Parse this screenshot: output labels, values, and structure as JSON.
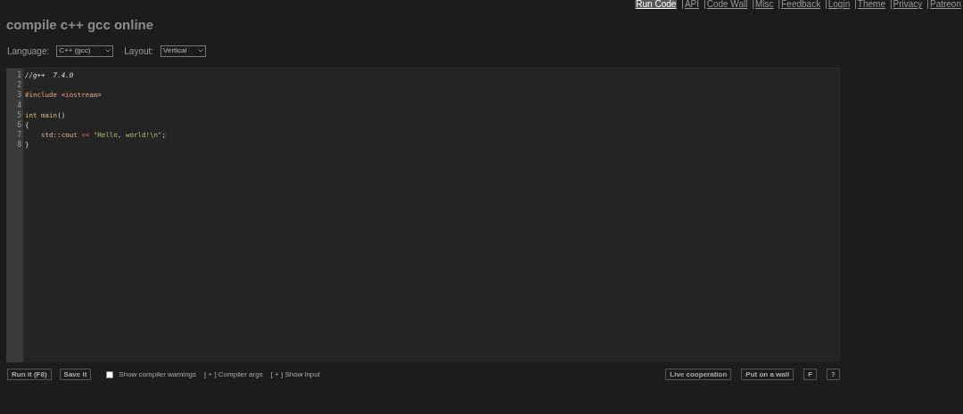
{
  "nav": [
    {
      "label": "Run Code",
      "selected": true
    },
    {
      "prefix": "|",
      "label": "API",
      "selected": false
    },
    {
      "prefix": "|",
      "label": "Code Wall",
      "selected": false
    },
    {
      "prefix": "|",
      "label": "Misc",
      "selected": false
    },
    {
      "prefix": "|",
      "label": "Feedback",
      "selected": false
    },
    {
      "prefix": "|",
      "label": "Login",
      "selected": false
    },
    {
      "prefix": "|",
      "label": "Theme",
      "selected": false
    },
    {
      "prefix": "|",
      "label": "Privacy",
      "selected": false
    },
    {
      "prefix": "|",
      "label": "Patreon",
      "selected": false
    }
  ],
  "title": "compile c++ gcc online",
  "options": [
    {
      "label": "Language:",
      "value": "C++ (gcc)"
    },
    {
      "label": "Layout:",
      "value": "Vertical"
    }
  ],
  "editor": {
    "lines": [
      {
        "number": "1",
        "tokens": [
          {
            "kind": "comment",
            "text": "//g++  7.4.0"
          }
        ]
      },
      {
        "number": "2"
      },
      {
        "number": "3",
        "tokens": [
          {
            "kind": "preprocessor",
            "text": "#include <iostream>"
          }
        ]
      },
      {
        "number": "4"
      },
      {
        "number": "5",
        "tokens": [
          {
            "kind": "keyword",
            "text": "int main"
          },
          {
            "kind": "plain",
            "text": "()"
          }
        ]
      },
      {
        "number": "6",
        "tokens": [
          {
            "kind": "plain",
            "text": "{"
          }
        ]
      },
      {
        "number": "7",
        "tokens": [
          {
            "kind": "keyword",
            "text": "    std::cout"
          },
          {
            "kind": "operator",
            "text": " << "
          },
          {
            "kind": "string",
            "text": "\"Hello, world!\\n\""
          },
          {
            "kind": "plain",
            "text": ";"
          }
        ]
      },
      {
        "number": "8",
        "tokens": [
          {
            "kind": "plain",
            "text": "}"
          }
        ]
      }
    ]
  },
  "bottom_left": [
    {
      "kind": "button",
      "label": "Run it (F8)"
    },
    {
      "kind": "button",
      "label": "Save it"
    },
    {
      "kind": "checkbox",
      "label": "Show compiler warnings",
      "checked": false
    },
    {
      "kind": "toggle",
      "label": "[ + ] Compiler args"
    },
    {
      "kind": "toggle",
      "label": "[ + ] Show input"
    }
  ],
  "bottom_right": [
    "Live cooperation",
    "Put on a wall",
    "F",
    "?"
  ]
}
